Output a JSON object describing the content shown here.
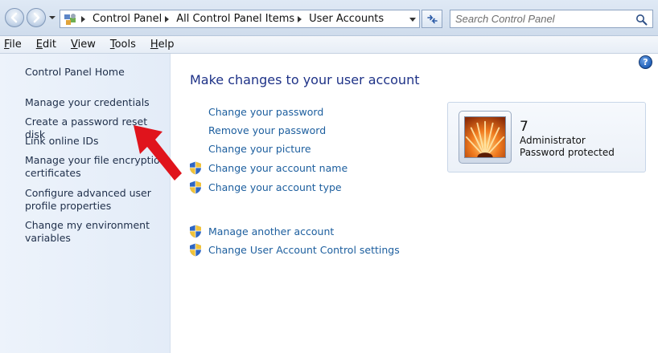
{
  "address_bar": {
    "breadcrumbs": [
      "Control Panel",
      "All Control Panel Items",
      "User Accounts"
    ],
    "search_placeholder": "Search Control Panel"
  },
  "menu": [
    {
      "accel": "F",
      "rest": "ile"
    },
    {
      "accel": "E",
      "rest": "dit"
    },
    {
      "accel": "V",
      "rest": "iew"
    },
    {
      "accel": "T",
      "rest": "ools"
    },
    {
      "accel": "H",
      "rest": "elp"
    }
  ],
  "left_pane": {
    "home": "Control Panel Home",
    "links": [
      "Manage your credentials",
      "Create a password reset disk",
      "Link online IDs",
      "Manage your file encryption certificates",
      "Configure advanced user profile properties",
      "Change my environment variables"
    ]
  },
  "main": {
    "title": "Make changes to your user account",
    "tasks": [
      {
        "label": "Change your password",
        "shield": false
      },
      {
        "label": "Remove your password",
        "shield": false
      },
      {
        "label": "Change your picture",
        "shield": false
      },
      {
        "label": "Change your account name",
        "shield": true
      },
      {
        "label": "Change your account type",
        "shield": true
      }
    ],
    "other_tasks": [
      {
        "label": "Manage another account",
        "shield": true
      },
      {
        "label": "Change User Account Control settings",
        "shield": true
      }
    ]
  },
  "user_card": {
    "name": "7",
    "role": "Administrator",
    "status": "Password protected"
  },
  "help_label": "?",
  "colors": {
    "link": "#1c5e9e",
    "title": "#1e3287",
    "annotation_arrow": "#e0141c"
  }
}
